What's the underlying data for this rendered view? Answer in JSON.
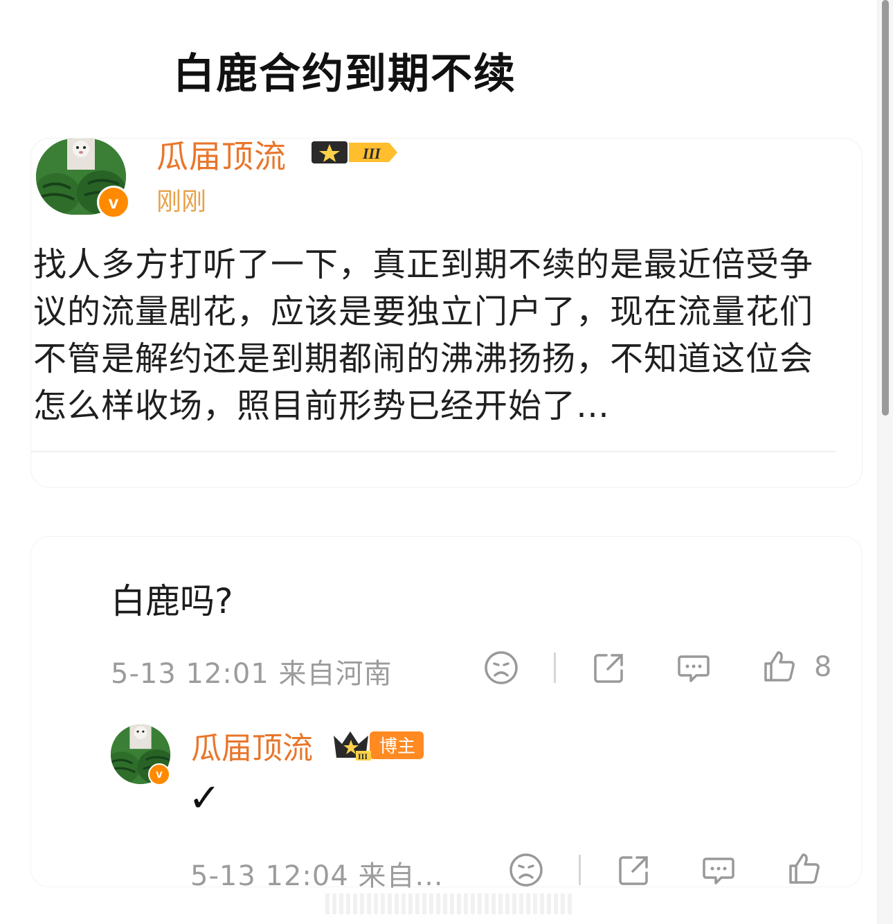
{
  "headline": "白鹿合约到期不续",
  "post": {
    "author": "瓜届顶流",
    "verified_badge": "v",
    "level": "III",
    "time": "刚刚",
    "text": "找人多方打听了一下，真正到期不续的是最近倍受争议的流量剧花，应该是要独立门户了，现在流量花们不管是解约还是到期都闹的沸沸扬扬，不知道这位会怎么样收场，照目前形势已经开始了…"
  },
  "comment": {
    "text": "白鹿吗?",
    "meta": "5-13 12:01 来自河南",
    "likes": "8"
  },
  "reply": {
    "author": "瓜届顶流",
    "verified_badge": "v",
    "level": "III",
    "badge_label": "博主",
    "text": "✓",
    "meta": "5-13 12:04 来自..."
  },
  "icons": [
    "dislike-face-icon",
    "share-icon",
    "comment-icon",
    "thumbs-up-icon"
  ],
  "colors": {
    "name": "#e8762b",
    "time": "#e8a14a",
    "meta": "#9c9c9c",
    "verified": "#ff8a00"
  }
}
